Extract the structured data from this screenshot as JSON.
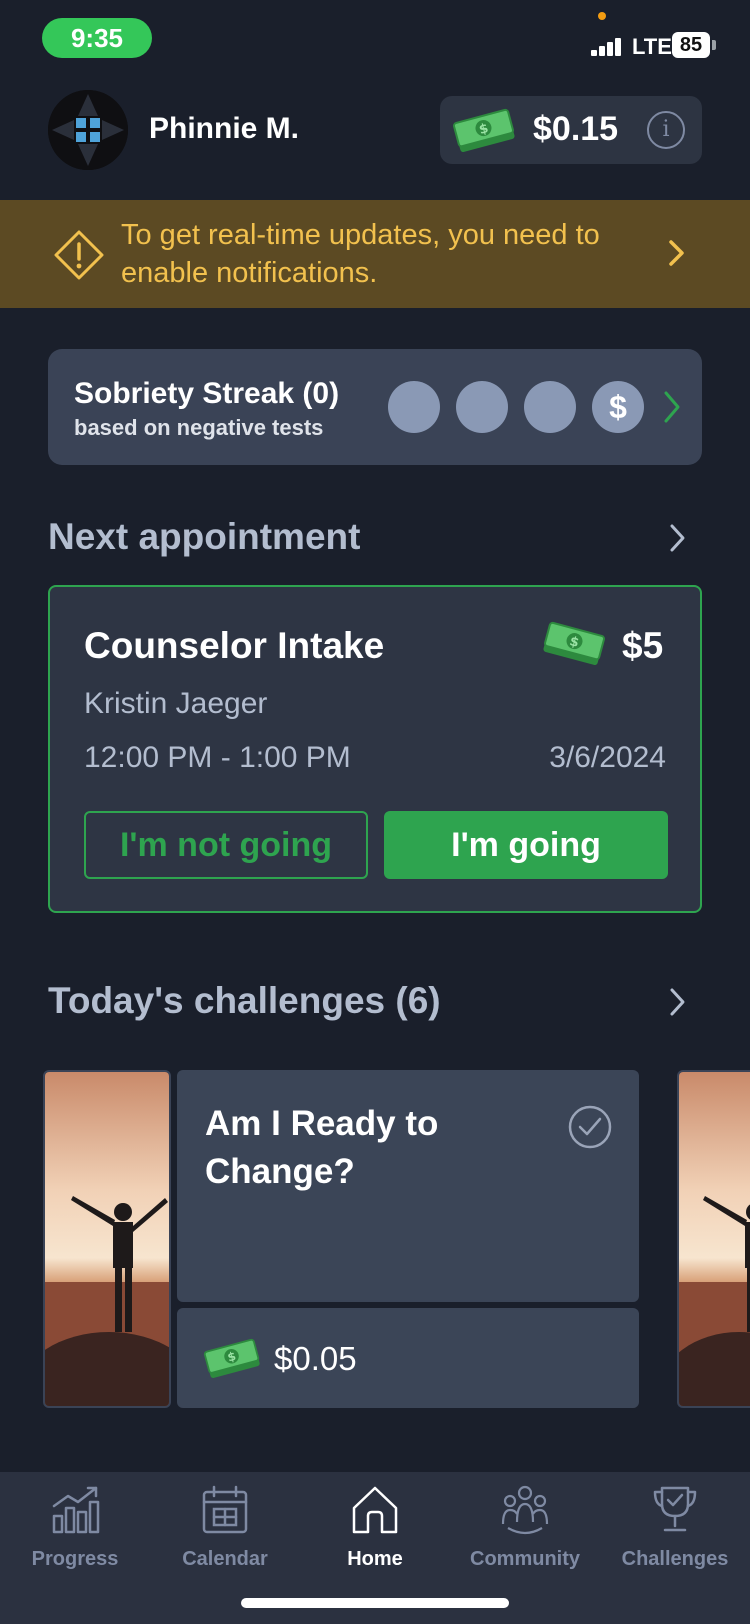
{
  "status_bar": {
    "time": "9:35",
    "network": "LTE",
    "battery": "85"
  },
  "header": {
    "user_name": "Phinnie M.",
    "balance": "$0.15"
  },
  "banner": {
    "text": "To get real-time updates, you need to enable notifications."
  },
  "streak": {
    "title": "Sobriety Streak (0)",
    "subtitle": "based on negative tests",
    "dollar_symbol": "$"
  },
  "appointment": {
    "section_title": "Next appointment",
    "title": "Counselor Intake",
    "reward": "$5",
    "counselor": "Kristin Jaeger",
    "time": "12:00 PM - 1:00 PM",
    "date": "3/6/2024",
    "not_going_label": "I'm not going",
    "going_label": "I'm going"
  },
  "challenges": {
    "section_title": "Today's challenges (6)",
    "card": {
      "title": "Am I Ready to Change?",
      "reward": "$0.05"
    }
  },
  "nav": {
    "items": [
      {
        "label": "Progress",
        "icon": "progress-chart-icon"
      },
      {
        "label": "Calendar",
        "icon": "calendar-icon"
      },
      {
        "label": "Home",
        "icon": "home-icon"
      },
      {
        "label": "Community",
        "icon": "community-icon"
      },
      {
        "label": "Challenges",
        "icon": "trophy-icon"
      }
    ],
    "active": "Home"
  },
  "colors": {
    "background": "#1a1f2b",
    "accent_green": "#2ea44f",
    "warning_yellow": "#f2c14e",
    "banner_bg": "#5c4a23",
    "card_bg": "#3a4356"
  }
}
